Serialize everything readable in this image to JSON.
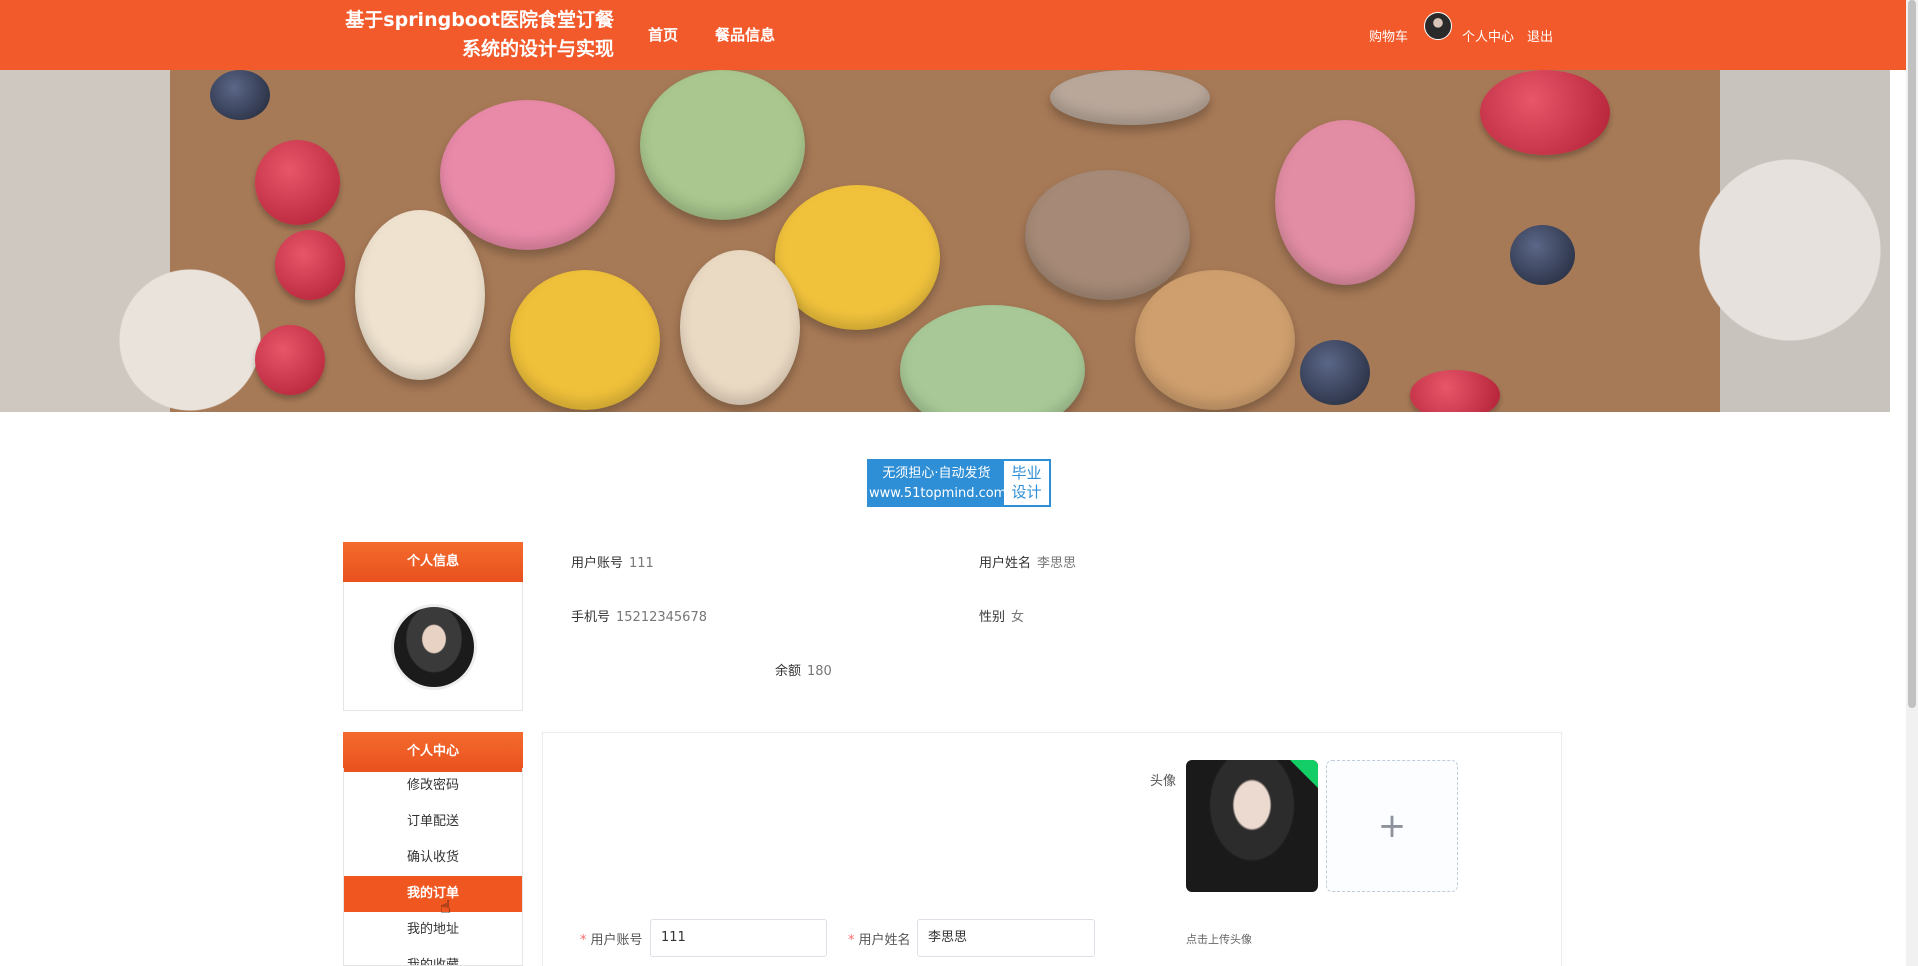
{
  "header": {
    "site_title": "基于springboot医院食堂订餐系统的设计与实现",
    "nav": {
      "home": "首页",
      "food_info": "餐品信息"
    },
    "cart": "购物车",
    "user_center": "个人中心",
    "logout": "退出"
  },
  "badge": {
    "line1": "无须担心·自动发货",
    "line2": "www.51topmind.com",
    "right1": "毕业",
    "right2": "设计"
  },
  "sidebar": {
    "info_title": "个人信息",
    "center_title": "个人中心",
    "items": [
      "修改密码",
      "订单配送",
      "确认收货",
      "我的订单",
      "我的地址",
      "我的收藏"
    ]
  },
  "user_info": {
    "account_label": "用户账号",
    "account_value": "111",
    "name_label": "用户姓名",
    "name_value": "李思思",
    "phone_label": "手机号",
    "phone_value": "15212345678",
    "gender_label": "性别",
    "gender_value": "女",
    "balance_label": "余额",
    "balance_value": "180"
  },
  "form": {
    "avatar_label": "头像",
    "upload_tip": "点击上传头像",
    "account_label": "用户账号",
    "account_value": "111",
    "name_label": "用户姓名",
    "name_value": "李思思"
  },
  "colors": {
    "primary": "#f25a2b",
    "active": "#f0561f",
    "badge": "#2f8fd6"
  }
}
